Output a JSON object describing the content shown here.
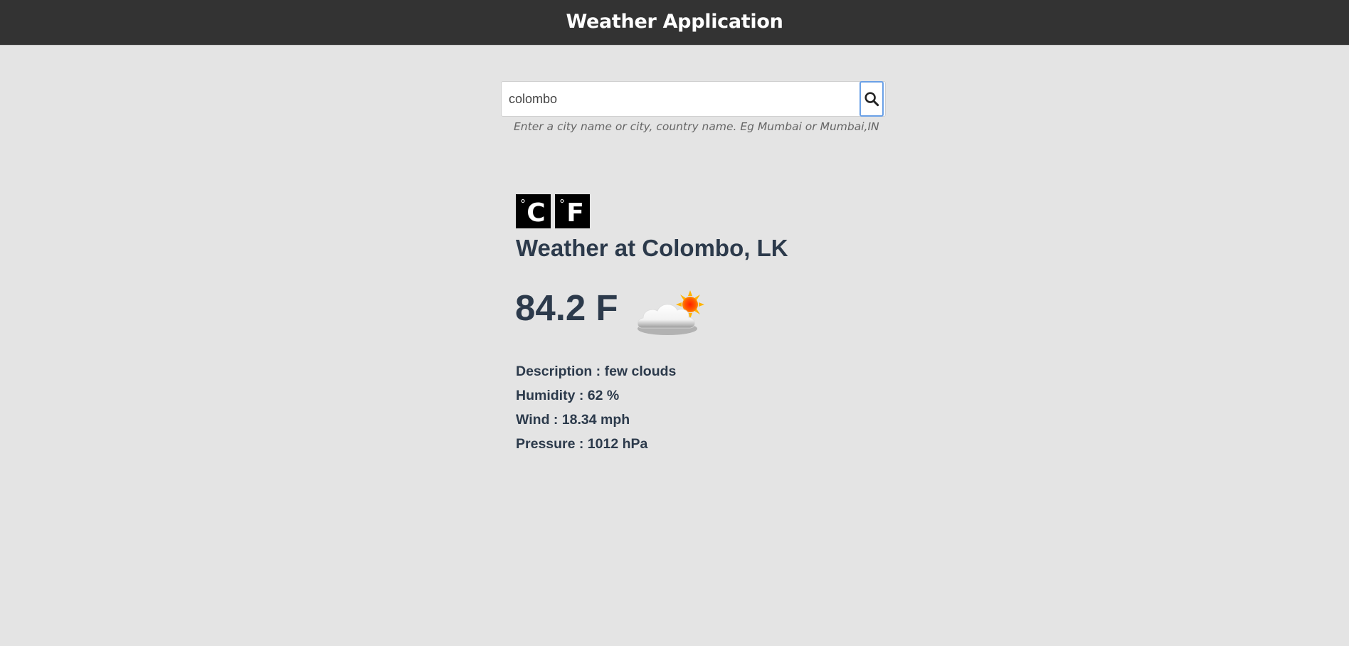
{
  "header": {
    "title": "Weather Application"
  },
  "search": {
    "value": "colombo",
    "hint": "Enter a city name or city, country name. Eg Mumbai or Mumbai,IN",
    "button_icon": "search-icon"
  },
  "units": {
    "celsius_symbol": "°",
    "celsius_letter": "C",
    "fahrenheit_symbol": "°",
    "fahrenheit_letter": "F"
  },
  "weather": {
    "location": "Weather at Colombo, LK",
    "temperature": "84.2 F",
    "icon": "few-clouds-icon",
    "details": {
      "description": "Description : few clouds",
      "humidity": "Humidity : 62 %",
      "wind": "Wind : 18.34 mph",
      "pressure": "Pressure : 1012 hPa"
    }
  },
  "colors": {
    "header_bg": "#333333",
    "page_bg": "#e4e4e4",
    "text_primary": "#2c3a4b",
    "focus_ring": "#6aa0e6"
  }
}
